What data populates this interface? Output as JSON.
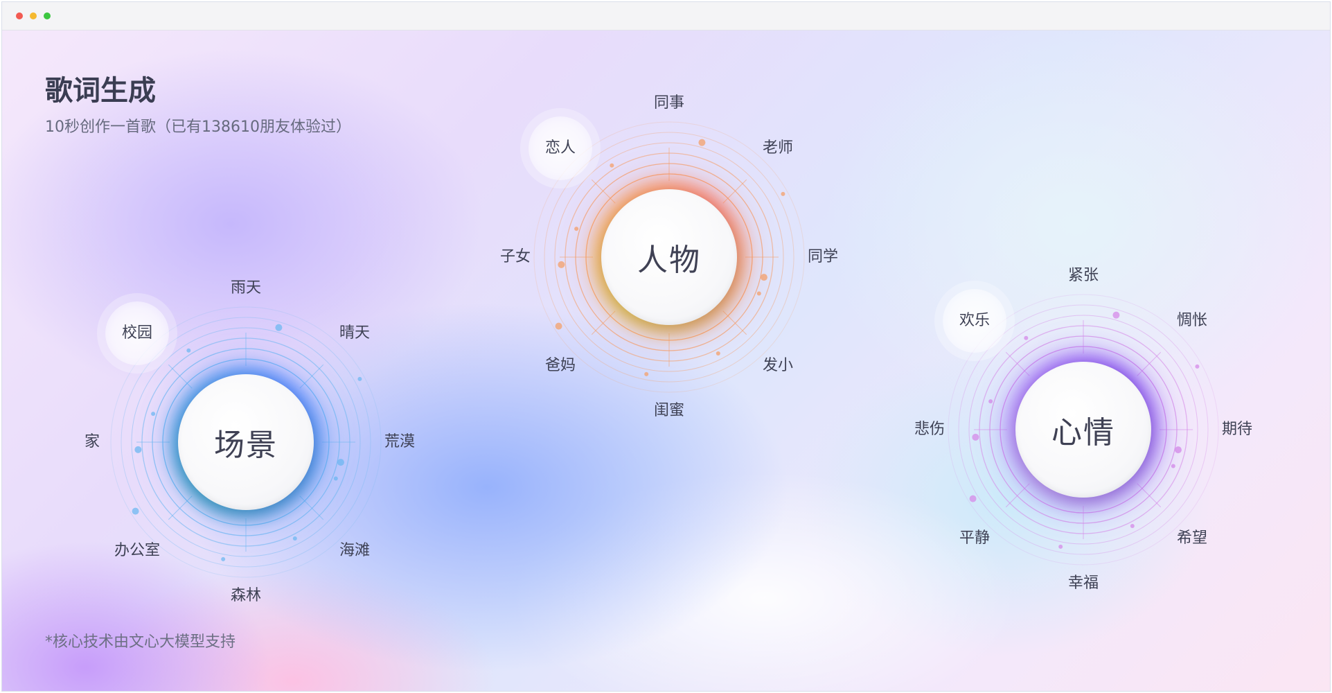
{
  "header": {
    "title": "歌词生成",
    "subtitle": "10秒创作一首歌（已有138610朋友体验过）"
  },
  "footer": {
    "note": "*核心技术由文心大模型支持"
  },
  "dials": {
    "scene": {
      "label": "场景",
      "ring_color": "#6fb8f2",
      "glow_colors": [
        "#3d7bff",
        "#12a6c8"
      ],
      "options": [
        "雨天",
        "晴天",
        "荒漠",
        "海滩",
        "森林",
        "办公室",
        "家",
        "校园"
      ],
      "selected": "校园"
    },
    "person": {
      "label": "人物",
      "ring_color": "#f4a06b",
      "glow_colors": [
        "#ff6a4d",
        "#ffd21f"
      ],
      "options": [
        "同事",
        "老师",
        "同学",
        "发小",
        "闺蜜",
        "爸妈",
        "子女",
        "恋人"
      ],
      "selected": "恋人"
    },
    "mood": {
      "label": "心情",
      "ring_color": "#d68ae8",
      "glow_colors": [
        "#7b3cf0",
        "#c58cff"
      ],
      "options": [
        "紧张",
        "惆怅",
        "期待",
        "希望",
        "幸福",
        "平静",
        "悲伤",
        "欢乐"
      ],
      "selected": "欢乐"
    }
  }
}
